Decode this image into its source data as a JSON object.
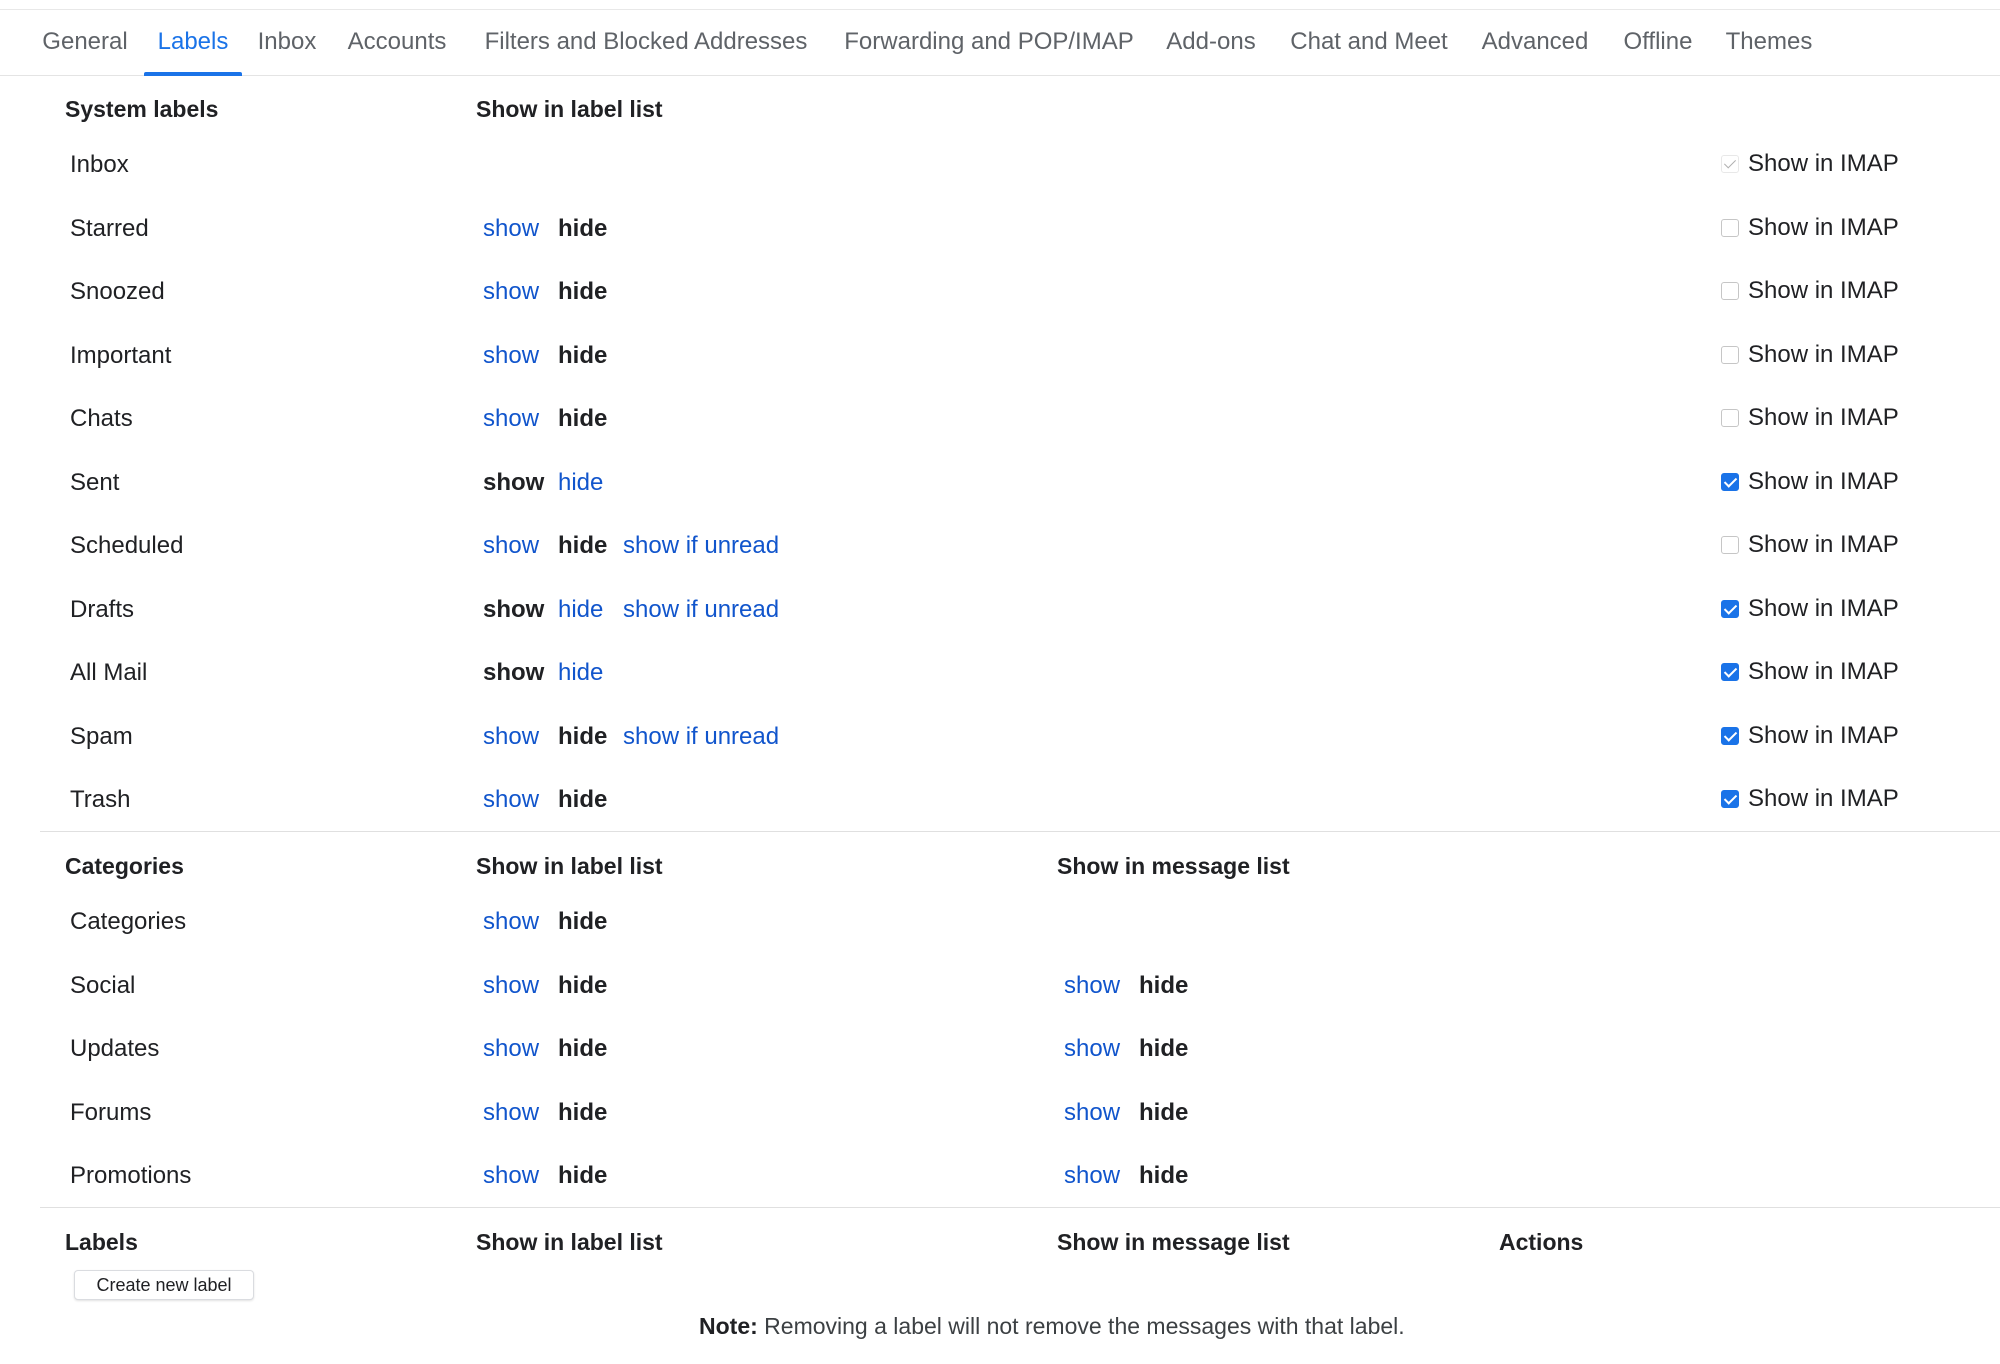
{
  "tabs": [
    {
      "label": "General"
    },
    {
      "label": "Labels"
    },
    {
      "label": "Inbox"
    },
    {
      "label": "Accounts"
    },
    {
      "label": "Filters and Blocked Addresses"
    },
    {
      "label": "Forwarding and POP/IMAP"
    },
    {
      "label": "Add-ons"
    },
    {
      "label": "Chat and Meet"
    },
    {
      "label": "Advanced"
    },
    {
      "label": "Offline"
    },
    {
      "label": "Themes"
    }
  ],
  "active_tab": "Labels",
  "colors": {
    "link": "#1155cc",
    "accent": "#1a73e8",
    "text": "#202124"
  },
  "option_text": {
    "show": "show",
    "hide": "hide",
    "show_if_unread": "show if unread"
  },
  "system": {
    "title": "System labels",
    "col_label_list": "Show in label list",
    "imap_label": "Show in IMAP",
    "rows": [
      {
        "name": "Inbox",
        "selected": "",
        "imap": "disabled-checked"
      },
      {
        "name": "Starred",
        "selected": "hide",
        "imap": "unchecked"
      },
      {
        "name": "Snoozed",
        "selected": "hide",
        "imap": "unchecked"
      },
      {
        "name": "Important",
        "selected": "hide",
        "imap": "unchecked"
      },
      {
        "name": "Chats",
        "selected": "hide",
        "imap": "unchecked"
      },
      {
        "name": "Sent",
        "selected": "show",
        "imap": "checked"
      },
      {
        "name": "Scheduled",
        "selected": "hide",
        "imap": "unchecked"
      },
      {
        "name": "Drafts",
        "selected": "show",
        "imap": "checked"
      },
      {
        "name": "All Mail",
        "selected": "show",
        "imap": "checked"
      },
      {
        "name": "Spam",
        "selected": "hide",
        "imap": "checked"
      },
      {
        "name": "Trash",
        "selected": "hide",
        "imap": "checked"
      }
    ]
  },
  "categories": {
    "title": "Categories",
    "col_label_list": "Show in label list",
    "col_message_list": "Show in message list",
    "rows": [
      {
        "name": "Categories",
        "label_list": "hide",
        "message_list": ""
      },
      {
        "name": "Social",
        "label_list": "hide",
        "message_list": "hide"
      },
      {
        "name": "Updates",
        "label_list": "hide",
        "message_list": "hide"
      },
      {
        "name": "Forums",
        "label_list": "hide",
        "message_list": "hide"
      },
      {
        "name": "Promotions",
        "label_list": "hide",
        "message_list": "hide"
      }
    ]
  },
  "labels": {
    "title": "Labels",
    "col_label_list": "Show in label list",
    "col_message_list": "Show in message list",
    "col_actions": "Actions",
    "create_button": "Create new label"
  },
  "note": {
    "bold": "Note:",
    "text": " Removing a label will not remove the messages with that label."
  }
}
